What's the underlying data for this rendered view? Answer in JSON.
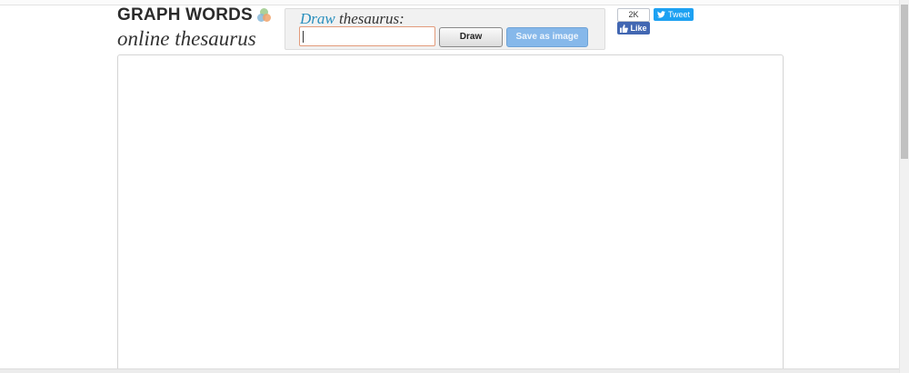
{
  "logo": {
    "title": "GRAPH WORDS",
    "subtitle": "online thesaurus",
    "icon": "three-circles-logo-icon"
  },
  "search": {
    "label_accent": "Draw",
    "label_rest": " thesaurus:",
    "input_value": "",
    "input_placeholder": "",
    "draw_label": "Draw",
    "save_label": "Save as image"
  },
  "social": {
    "fb_count": "2K",
    "fb_like_label": "Like",
    "tweet_label": "Tweet",
    "colors": {
      "facebook": "#4267b2",
      "twitter": "#1da1f2"
    }
  },
  "colors": {
    "accent": "#2a8fbd",
    "save_button": "#86b8ea",
    "input_border": "#e29a7a"
  }
}
